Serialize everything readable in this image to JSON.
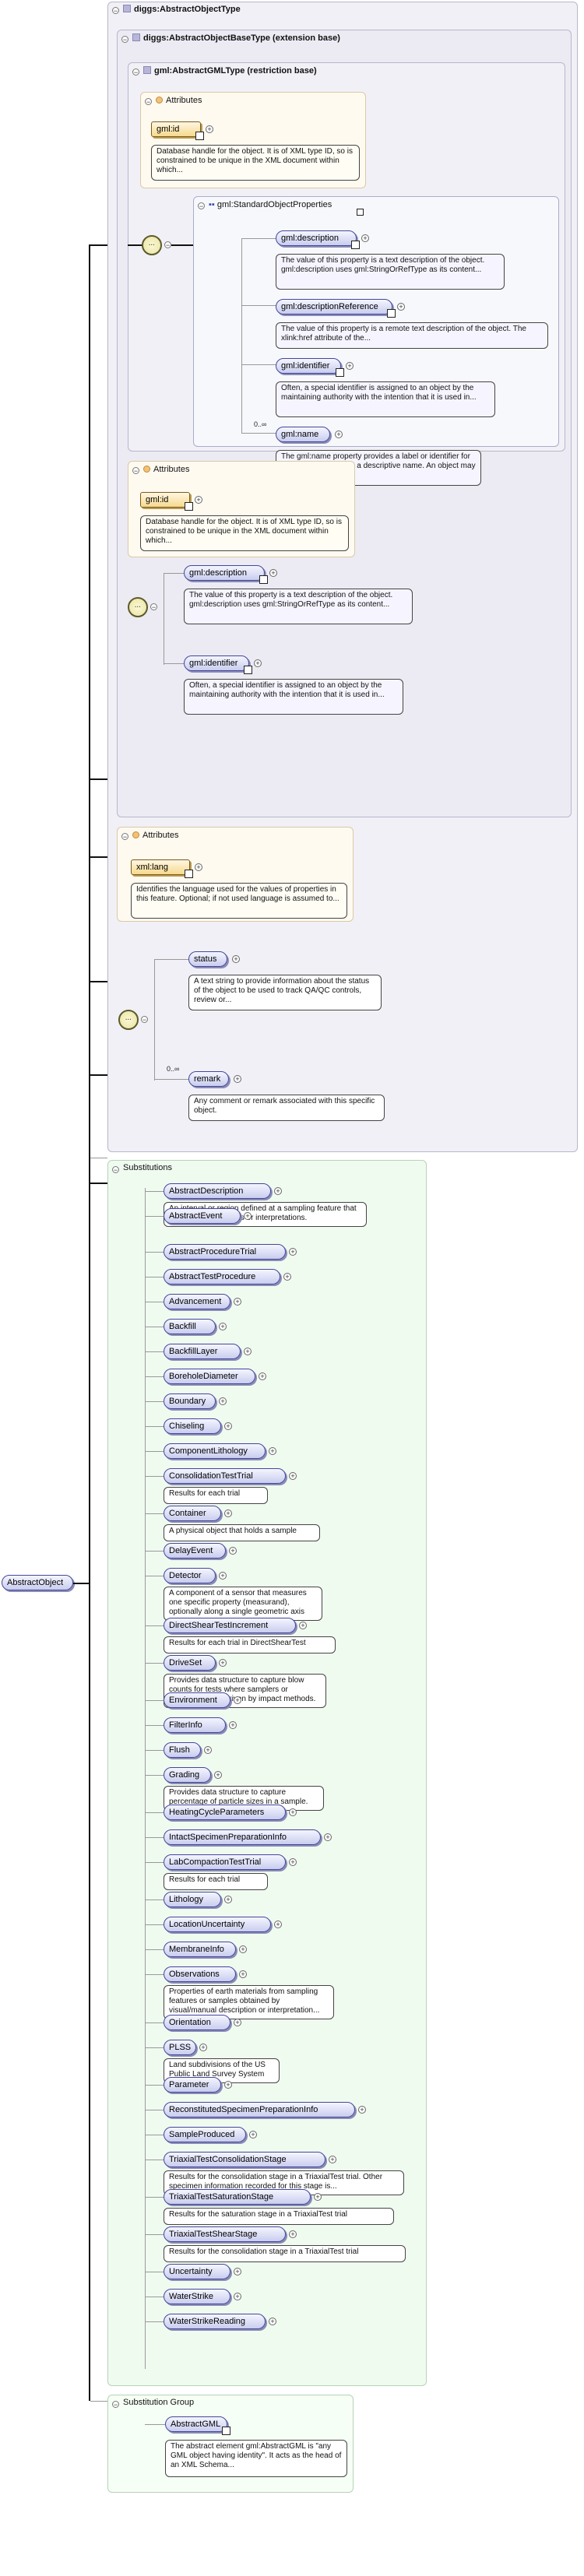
{
  "root": {
    "label": "AbstractObject"
  },
  "types": {
    "object_type": "diggs:AbstractObjectType",
    "base_type": "diggs:AbstractObjectBaseType (extension base)",
    "gml_type": "gml:AbstractGMLType (restriction base)",
    "std_props": "gml:StandardObjectProperties"
  },
  "labels": {
    "attributes": "Attributes",
    "substitutions": "Substitutions",
    "substitution_group": "Substitution Group",
    "occurrence": "0..∞"
  },
  "gml_attr": {
    "name": "gml:id",
    "doc": "Database handle for the object. It is of XML type ID, so is constrained to be unique in the XML document within which..."
  },
  "std_elements": [
    {
      "name": "gml:description",
      "doc": "The value of this property is a text description of the object. gml:description uses gml:StringOrRefType as its content..."
    },
    {
      "name": "gml:descriptionReference",
      "doc": "The value of this property is a remote text description of the object. The xlink:href attribute of the..."
    },
    {
      "name": "gml:identifier",
      "doc": "Often, a special identifier is assigned to an object by the maintaining authority with the intention that it is used in..."
    },
    {
      "name": "gml:name",
      "doc": "The gml:name property provides a label or identifier for the object, commonly a descriptive name. An object may have..."
    }
  ],
  "base_attr": {
    "name": "gml:id",
    "doc": "Database handle for the object. It is of XML type ID, so is constrained to be unique in the XML document within which..."
  },
  "base_elements": [
    {
      "name": "gml:description",
      "doc": "The value of this property is a text description of the object. gml:description uses gml:StringOrRefType as its content..."
    },
    {
      "name": "gml:identifier",
      "doc": "Often, a special identifier is assigned to an object by the maintaining authority with the intention that it is used in..."
    }
  ],
  "object_attr": {
    "name": "xml:lang",
    "doc": "Identifies the language used for the values of properties in this feature. Optional; if not used language is assumed to..."
  },
  "object_elements": [
    {
      "name": "status",
      "doc": "A text string to provide information about the status of the object to be used to track QA/QC controls, review or..."
    },
    {
      "name": "remark",
      "doc": "Any comment or remark associated with this specific object."
    }
  ],
  "substitutions": [
    {
      "name": "AbstractDescription",
      "doc": "An interval or region defined at a sampling feature that contains observations or interpretations."
    },
    {
      "name": "AbstractEvent",
      "doc": ""
    },
    {
      "name": "AbstractProcedureTrial",
      "doc": ""
    },
    {
      "name": "AbstractTestProcedure",
      "doc": ""
    },
    {
      "name": "Advancement",
      "doc": ""
    },
    {
      "name": "Backfill",
      "doc": ""
    },
    {
      "name": "BackfillLayer",
      "doc": ""
    },
    {
      "name": "BoreholeDiameter",
      "doc": ""
    },
    {
      "name": "Boundary",
      "doc": ""
    },
    {
      "name": "Chiseling",
      "doc": ""
    },
    {
      "name": "ComponentLithology",
      "doc": ""
    },
    {
      "name": "ConsolidationTestTrial",
      "doc": "Results for each trial"
    },
    {
      "name": "Container",
      "doc": "A physical object that holds a sample"
    },
    {
      "name": "DelayEvent",
      "doc": ""
    },
    {
      "name": "Detector",
      "doc": "A component of a sensor that measures one specific property (measurand), optionally along a single geometric axis"
    },
    {
      "name": "DirectShearTestIncrement",
      "doc": "Results for each trial in DirectShearTest"
    },
    {
      "name": "DriveSet",
      "doc": "Provides data structure to capture blow counts for tests where samplers or instruments are driven by impact methods."
    },
    {
      "name": "Environment",
      "doc": ""
    },
    {
      "name": "FilterInfo",
      "doc": ""
    },
    {
      "name": "Flush",
      "doc": ""
    },
    {
      "name": "Grading",
      "doc": "Provides data structure to capture percentage of particle sizes in a sample."
    },
    {
      "name": "HeatingCycleParameters",
      "doc": ""
    },
    {
      "name": "IntactSpecimenPreparationInfo",
      "doc": ""
    },
    {
      "name": "LabCompactionTestTrial",
      "doc": "Results for each trial"
    },
    {
      "name": "Lithology",
      "doc": ""
    },
    {
      "name": "LocationUncertainty",
      "doc": ""
    },
    {
      "name": "MembraneInfo",
      "doc": ""
    },
    {
      "name": "Observations",
      "doc": "Properties of earth materials from sampling features or samples obtained by visual/manual description or interpretation..."
    },
    {
      "name": "Orientation",
      "doc": ""
    },
    {
      "name": "PLSS",
      "doc": "Land subdivisions of the US Public Land Survey System"
    },
    {
      "name": "Parameter",
      "doc": ""
    },
    {
      "name": "ReconstitutedSpecimenPreparationInfo",
      "doc": ""
    },
    {
      "name": "SampleProduced",
      "doc": ""
    },
    {
      "name": "TriaxialTestConsolidationStage",
      "doc": "Results for the consolidation stage in a TriaxialTest trial. Other specimen information recorded for this stage is..."
    },
    {
      "name": "TriaxialTestSaturationStage",
      "doc": "Results for the saturation stage in a TriaxialTest trial"
    },
    {
      "name": "TriaxialTestShearStage",
      "doc": "Results for the consolidation stage in a TriaxialTest trial"
    },
    {
      "name": "Uncertainty",
      "doc": ""
    },
    {
      "name": "WaterStrike",
      "doc": ""
    },
    {
      "name": "WaterStrikeReading",
      "doc": ""
    }
  ],
  "group": {
    "name": "AbstractGML",
    "doc": "The abstract element gml:AbstractGML is \"any GML object having identity\". It acts as the head of an XML Schema..."
  }
}
